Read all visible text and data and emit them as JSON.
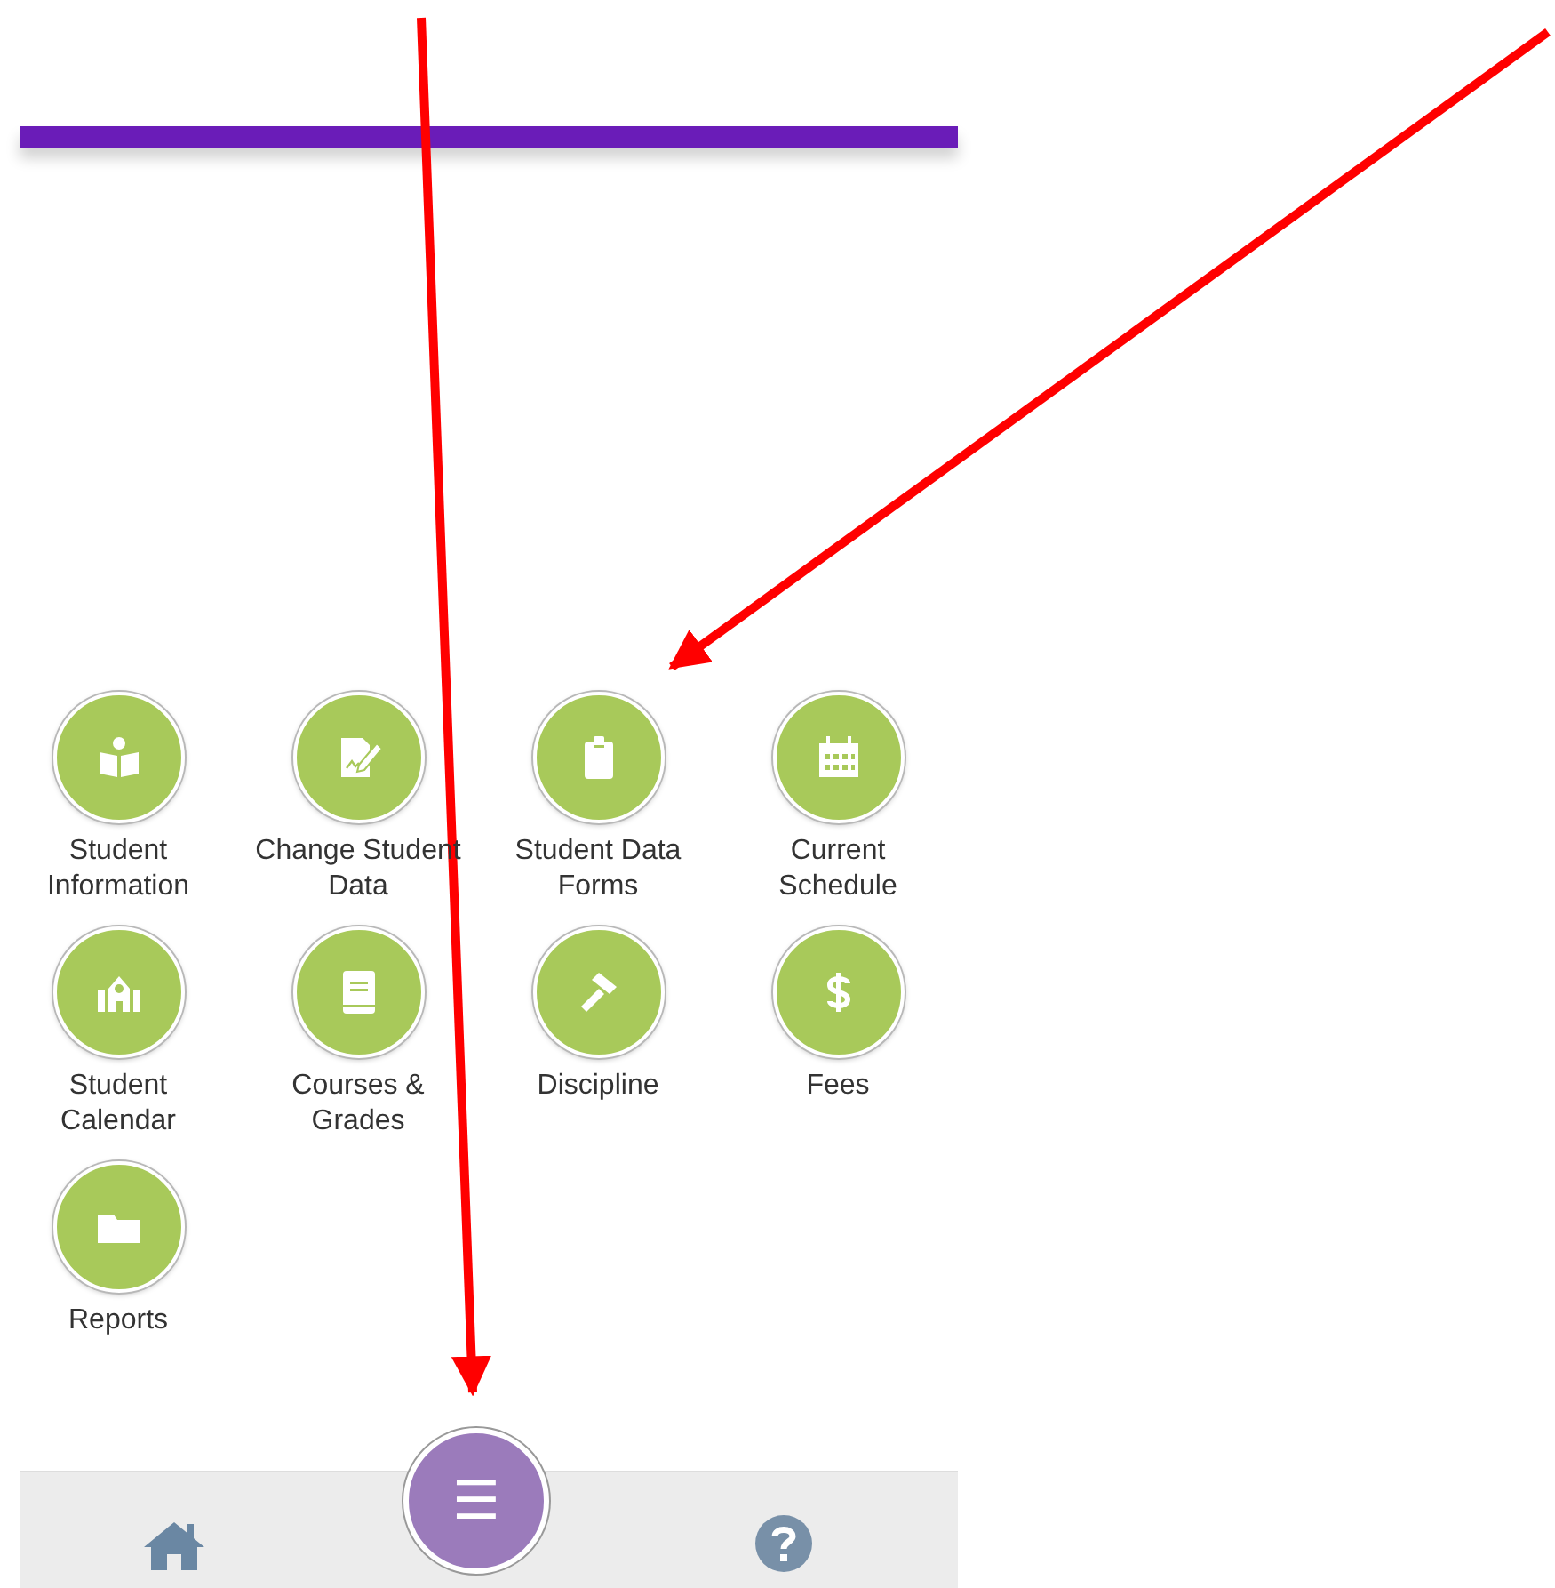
{
  "tiles": [
    {
      "label": "Student Information"
    },
    {
      "label": "Change Student Data"
    },
    {
      "label": "Student Data Forms"
    },
    {
      "label": "Current Schedule"
    },
    {
      "label": "Student Calendar"
    },
    {
      "label": "Courses & Grades"
    },
    {
      "label": "Discipline"
    },
    {
      "label": "Fees"
    },
    {
      "label": "Reports"
    }
  ],
  "bottom_bar": {
    "menu_button": "☰"
  }
}
